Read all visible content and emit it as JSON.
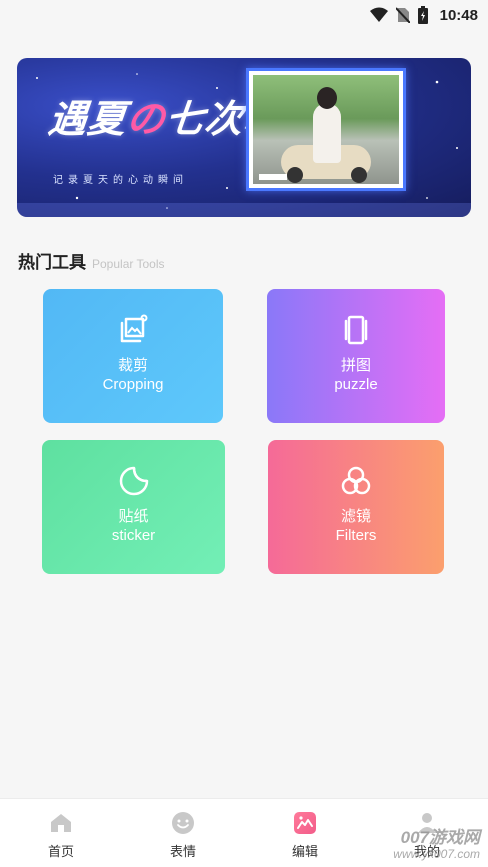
{
  "status_bar": {
    "time": "10:48",
    "icons": [
      "wifi-icon",
      "no-sim-icon",
      "battery-icon"
    ]
  },
  "banner": {
    "title_part1": "遇夏",
    "title_dot": "の",
    "title_part2": "七次心动",
    "subtitle": "记录夏天的心动瞬间"
  },
  "section": {
    "title": "热门工具",
    "subtitle": "Popular Tools"
  },
  "tools": [
    {
      "cn": "裁剪",
      "en": "Cropping",
      "icon": "crop-icon",
      "colors": [
        "#52b8f5",
        "#5ec8fb"
      ]
    },
    {
      "cn": "拼图",
      "en": "puzzle",
      "icon": "collage-icon",
      "colors": [
        "#8a78f8",
        "#e56ef5"
      ]
    },
    {
      "cn": "贴纸",
      "en": "sticker",
      "icon": "sticker-icon",
      "colors": [
        "#5ee0a0",
        "#73efb6"
      ]
    },
    {
      "cn": "滤镜",
      "en": "Filters",
      "icon": "filter-icon",
      "colors": [
        "#f56a98",
        "#fb9f6d"
      ]
    }
  ],
  "nav": [
    {
      "label": "首页",
      "icon": "home-icon",
      "active": false
    },
    {
      "label": "表情",
      "icon": "emoji-icon",
      "active": false
    },
    {
      "label": "编辑",
      "icon": "edit-image-icon",
      "active": true
    },
    {
      "label": "我的",
      "icon": "user-icon",
      "active": false
    }
  ],
  "watermark": {
    "line1": "007游戏网",
    "line2": "www.yx007.com"
  }
}
